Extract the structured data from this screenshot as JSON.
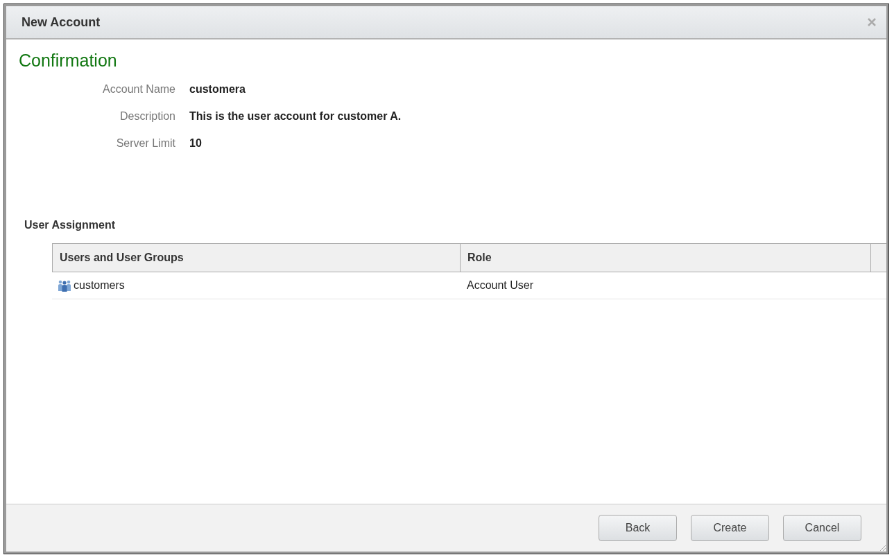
{
  "window": {
    "title": "New Account"
  },
  "heading": "Confirmation",
  "fields": [
    {
      "label": "Account Name",
      "value": "customera"
    },
    {
      "label": "Description",
      "value": "This is the user account for customer A."
    },
    {
      "label": "Server Limit",
      "value": "10"
    }
  ],
  "user_assignment": {
    "title": "User Assignment",
    "table": {
      "columns": [
        "Users and User Groups",
        "Role"
      ],
      "rows": [
        {
          "name": "customers",
          "role": "Account User"
        }
      ]
    }
  },
  "buttons": [
    "Back",
    "Create",
    "Cancel"
  ]
}
